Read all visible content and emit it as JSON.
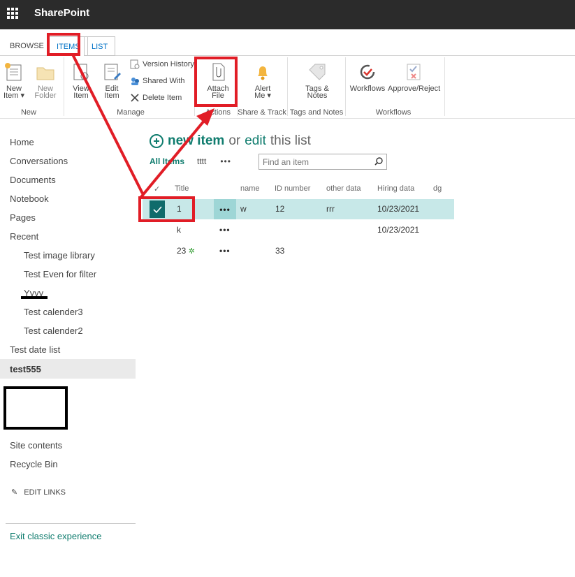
{
  "suite_bar": {
    "brand": "SharePoint"
  },
  "ribbon_tabs": {
    "browse": "BROWSE",
    "items": "ITEMS",
    "list": "LIST"
  },
  "ribbon": {
    "new_item": [
      "New",
      "Item"
    ],
    "new_folder": [
      "New",
      "Folder"
    ],
    "group_new": "New",
    "view_item": [
      "View",
      "Item"
    ],
    "edit_item": [
      "Edit",
      "Item"
    ],
    "version_history": "Version History",
    "shared_with": "Shared With",
    "delete_item": "Delete Item",
    "group_manage": "Manage",
    "attach_file": [
      "Attach",
      "File"
    ],
    "group_actions": "Actions",
    "alert_me": [
      "Alert",
      "Me"
    ],
    "group_share_track": "Share & Track",
    "tags_notes": [
      "Tags &",
      "Notes"
    ],
    "group_tags_notes": "Tags and Notes",
    "workflows": "Workflows",
    "approve_reject": "Approve/Reject",
    "group_workflows": "Workflows"
  },
  "nav": {
    "home": "Home",
    "conversations": "Conversations",
    "documents": "Documents",
    "notebook": "Notebook",
    "pages": "Pages",
    "recent": "Recent",
    "recent_items": [
      "Test image library",
      "Test Even for filter",
      "Yyyy",
      "Test calender3",
      "Test calender2"
    ],
    "test_date_list": "Test date list",
    "test555": "test555",
    "site_contents": "Site contents",
    "recycle_bin": "Recycle Bin",
    "edit_links": "EDIT LINKS",
    "exit_classic": "Exit classic experience"
  },
  "list": {
    "new_item": "new item",
    "or": "or",
    "edit": "edit",
    "this_list": "this list",
    "view_all": "All Items",
    "view_tttt": "tttt",
    "search_placeholder": "Find an item",
    "columns": {
      "title": "Title",
      "name": "name",
      "id_number": "ID number",
      "other_data": "other data",
      "hiring_data": "Hiring data",
      "dg": "dg"
    },
    "rows": [
      {
        "title": "1",
        "name": "w",
        "id_number": "12",
        "other_data": "rrr",
        "hiring_data": "10/23/2021"
      },
      {
        "title": "k",
        "name": "",
        "id_number": "",
        "other_data": "",
        "hiring_data": "10/23/2021"
      },
      {
        "title": "23",
        "name": "",
        "id_number": "33",
        "other_data": "",
        "hiring_data": ""
      }
    ]
  },
  "colors": {
    "accent": "#0f7c6e",
    "annotation_red": "#e11d26",
    "selected_row": "#c7e8e8"
  }
}
